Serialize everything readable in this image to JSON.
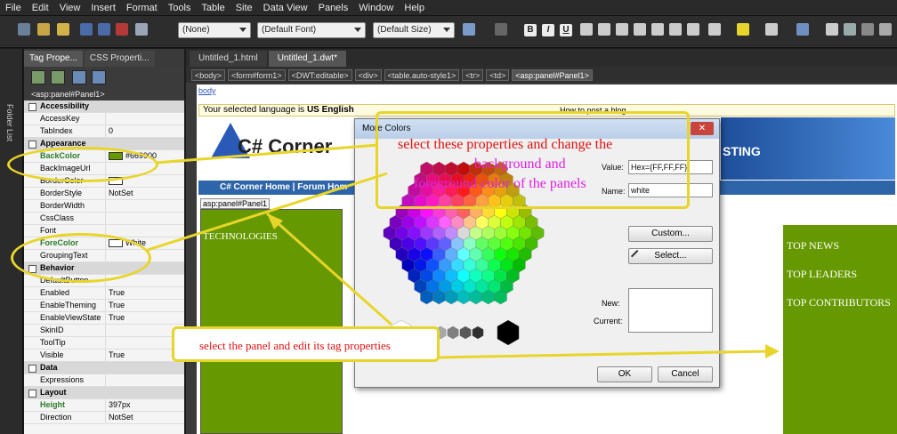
{
  "menu": [
    "File",
    "Edit",
    "View",
    "Insert",
    "Format",
    "Tools",
    "Table",
    "Site",
    "Data View",
    "Panels",
    "Window",
    "Help"
  ],
  "toolbar": {
    "style_select": "(None)",
    "font_select": "(Default Font)",
    "size_select": "(Default Size)",
    "bold": "B",
    "italic": "I",
    "underline": "U"
  },
  "folder_list_label": "Folder List",
  "left_panel": {
    "tabs": [
      "Tag Prope...",
      "CSS Properti..."
    ],
    "tag_name": "<asp:panel#Panel1>",
    "rows": [
      {
        "type": "cat",
        "name": "Accessibility"
      },
      {
        "name": "AccessKey",
        "value": ""
      },
      {
        "name": "TabIndex",
        "value": "0"
      },
      {
        "type": "cat",
        "name": "Appearance"
      },
      {
        "name": "BackColor",
        "value": "#669900",
        "swatch": "#669900",
        "hl": true
      },
      {
        "name": "BackImageUrl",
        "value": ""
      },
      {
        "name": "BorderColor",
        "value": "",
        "swatch": "#ffffff"
      },
      {
        "name": "BorderStyle",
        "value": "NotSet"
      },
      {
        "name": "BorderWidth",
        "value": ""
      },
      {
        "name": "CssClass",
        "value": ""
      },
      {
        "name": "Font",
        "value": ""
      },
      {
        "name": "ForeColor",
        "value": "White",
        "swatch": "#ffffff",
        "hl": true
      },
      {
        "name": "GroupingText",
        "value": ""
      },
      {
        "type": "cat",
        "name": "Behavior"
      },
      {
        "name": "DefaultButton",
        "value": ""
      },
      {
        "name": "Enabled",
        "value": "True"
      },
      {
        "name": "EnableTheming",
        "value": "True"
      },
      {
        "name": "EnableViewState",
        "value": "True"
      },
      {
        "name": "SkinID",
        "value": ""
      },
      {
        "name": "ToolTip",
        "value": ""
      },
      {
        "name": "Visible",
        "value": "True"
      },
      {
        "type": "cat",
        "name": "Data"
      },
      {
        "name": "Expressions",
        "value": ""
      },
      {
        "type": "cat",
        "name": "Layout"
      },
      {
        "name": "Height",
        "value": "397px",
        "hl": true
      },
      {
        "name": "Direction",
        "value": "NotSet"
      }
    ]
  },
  "doc_tabs": [
    "Untitled_1.html",
    "Untitled_1.dwt*"
  ],
  "tag_path": [
    "<body>",
    "<form#form1>",
    "<DWT:editable>",
    "<div>",
    "<table.auto-style1>",
    "<tr>",
    "<td>",
    "<asp:panel#Panel1>"
  ],
  "page": {
    "body_label": "body",
    "language_prefix": "Your selected language is ",
    "language": "US English",
    "how_to_post": "How to post a blog",
    "site_logo": "C# Corner",
    "nav_text": "C# Corner Home | Forum Hom",
    "banner_text": "STING",
    "panel_tag": "asp:panel#Panel1",
    "left_panel_text": "TECHNOLOGIES",
    "right_items": [
      "TOP NEWS",
      "TOP LEADERS",
      "TOP CONTRIBUTORS"
    ]
  },
  "dialog": {
    "title": "More Colors",
    "value_label": "Value:",
    "value": "Hex={FF,FF,FF}",
    "name_label": "Name:",
    "name_value": "white",
    "custom_btn": "Custom...",
    "select_btn": "Select...",
    "new_label": "New:",
    "current_label": "Current:",
    "ok": "OK",
    "cancel": "Cancel"
  },
  "annotations": {
    "line1": "select these properties and change the",
    "line2": "background and",
    "line3": "foreground color of the panels",
    "panel_note": "select the panel and edit its tag properties"
  },
  "colors": {
    "panel_green": "#669900",
    "annotation_yellow": "#e8d52a",
    "annotation_red": "#e01010",
    "annotation_magenta": "#e020e0"
  }
}
